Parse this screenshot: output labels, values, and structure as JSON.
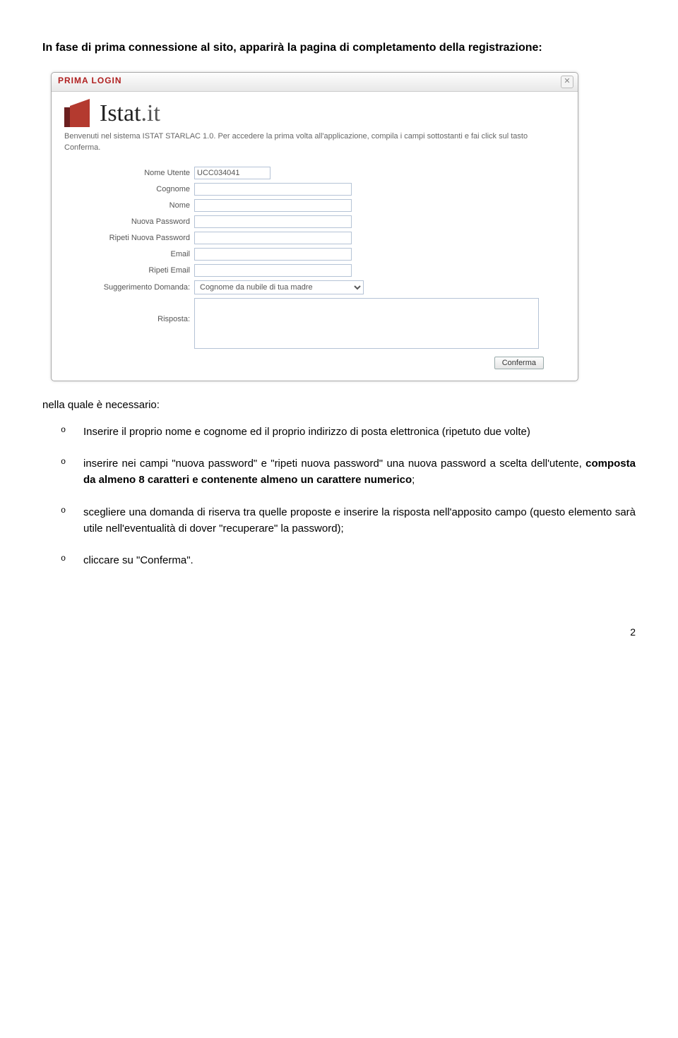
{
  "intro": "In fase di prima connessione al sito, apparirà la pagina di completamento della registrazione:",
  "dialog": {
    "title": "PRIMA LOGIN",
    "close_glyph": "✕",
    "logo_brand": "Istat",
    "logo_suffix": ".it",
    "welcome": "Benvenuti nel sistema ISTAT STARLAC 1.0. Per accedere la prima volta all'applicazione, compila i campi sottostanti e fai click sul tasto Conferma.",
    "fields": {
      "nome_utente_label": "Nome Utente",
      "nome_utente_value": "UCC034041",
      "cognome_label": "Cognome",
      "cognome_value": "",
      "nome_label": "Nome",
      "nome_value": "",
      "nuova_password_label": "Nuova Password",
      "nuova_password_value": "",
      "ripeti_password_label": "Ripeti Nuova Password",
      "ripeti_password_value": "",
      "email_label": "Email",
      "email_value": "",
      "ripeti_email_label": "Ripeti Email",
      "ripeti_email_value": "",
      "suggerimento_label": "Suggerimento Domanda:",
      "suggerimento_value": "Cognome da nubile di tua madre",
      "risposta_label": "Risposta:",
      "risposta_value": ""
    },
    "confirm_label": "Conferma"
  },
  "necessario": "nella quale è necessario:",
  "bullets": {
    "b1": "Inserire il proprio nome e cognome ed il proprio indirizzo di posta elettronica (ripetuto due volte)",
    "b2_pre": "inserire nei campi \"nuova password\" e \"ripeti nuova password\" una nuova password a scelta dell'utente, ",
    "b2_bold": "composta da almeno 8 caratteri e contenente almeno un carattere numerico",
    "b2_post": ";",
    "b3": "scegliere una domanda di riserva tra quelle proposte e inserire la risposta nell'apposito campo (questo elemento sarà utile nell'eventualità di dover \"recuperare\" la password);",
    "b4": "cliccare su \"Conferma\"."
  },
  "page_number": "2"
}
